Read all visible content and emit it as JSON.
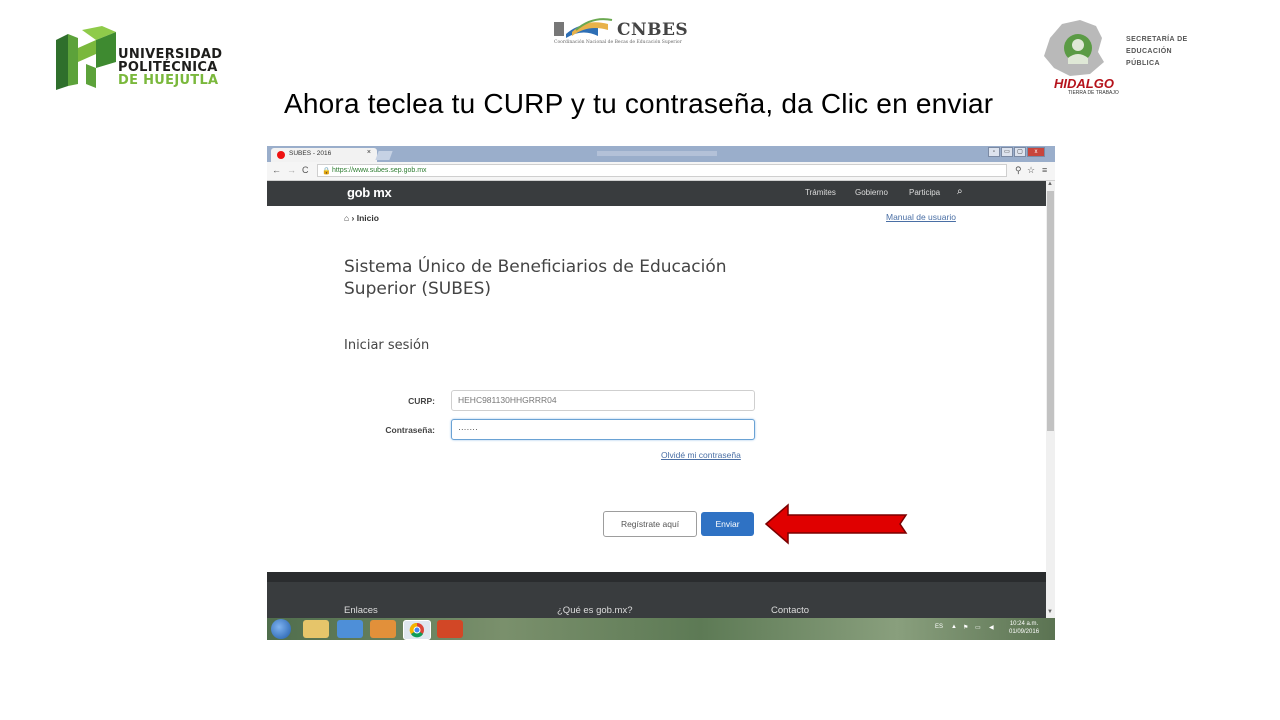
{
  "slide": {
    "logo_left": {
      "line1": "UNIVERSIDAD",
      "line2": "POLITÉCNICA",
      "line3": "DE HUEJUTLA"
    },
    "logo_center": {
      "name": "CNBES",
      "subtitle": "Coordinación Nacional de Becas de Educación Superior"
    },
    "logo_right": {
      "state": "HIDALGO",
      "tagline": "TIERRA DE TRABAJO",
      "line1": "SECRETARÍA DE",
      "line2": "EDUCACIÓN",
      "line3": "PÚBLICA"
    },
    "instruction": "Ahora teclea tu CURP y tu contraseña, da Clic en enviar"
  },
  "browser": {
    "tab_title": "SUBES - 2016",
    "tab_close": "×",
    "url": "https://www.subes.sep.gob.mx",
    "window_buttons": [
      "▫",
      "▭",
      "▢",
      "x"
    ]
  },
  "site": {
    "brand": "gob mx",
    "nav": [
      "Trámites",
      "Gobierno",
      "Participa"
    ],
    "breadcrumb": "Inicio",
    "manual_link": "Manual de usuario",
    "title": "Sistema Único de Beneficiarios de Educación Superior (SUBES)",
    "section": "Iniciar sesión",
    "curp_label": "CURP:",
    "curp_value": "HEHC981130HHGRRR04",
    "password_label": "Contraseña:",
    "password_value": "·······",
    "forgot_link": "Olvidé mi contraseña",
    "register_button": "Regístrate aquí",
    "send_button": "Enviar",
    "footer": [
      "Enlaces",
      "¿Qué es gob.mx?",
      "Contacto"
    ]
  },
  "taskbar": {
    "language": "ES",
    "time": "10:24 a.m.",
    "date": "01/09/2016"
  },
  "colors": {
    "arrow": "#e00000",
    "send_button": "#2f72c4",
    "gob_bar": "#393c3e"
  }
}
